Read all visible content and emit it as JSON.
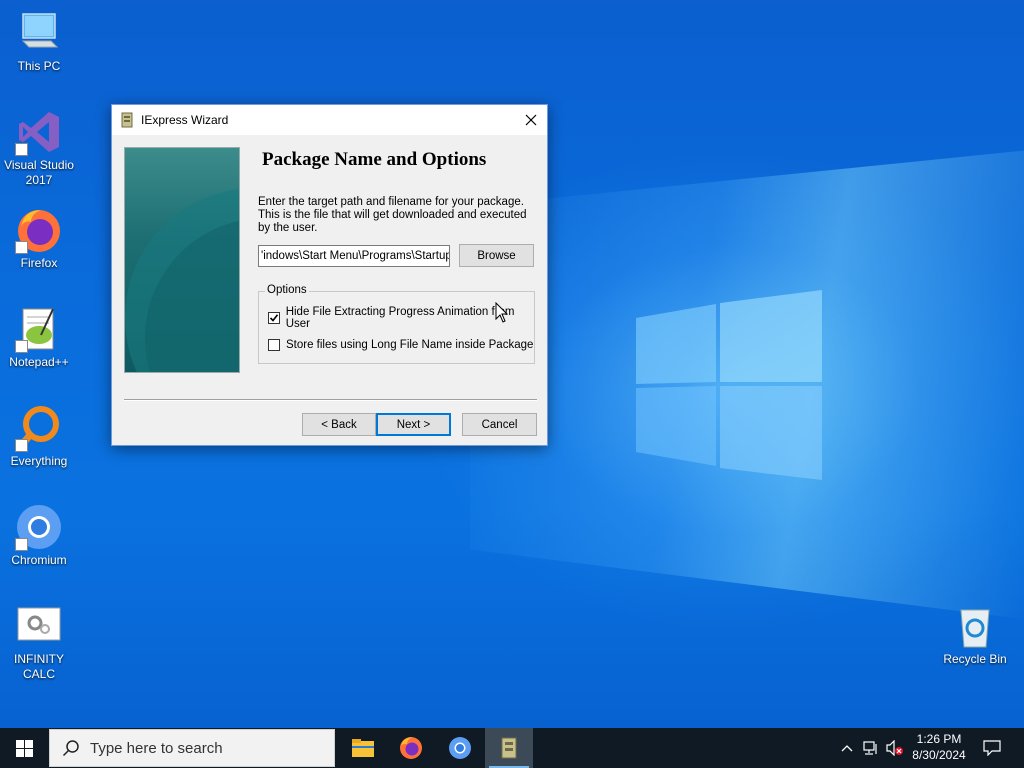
{
  "desktop": {
    "icons": [
      {
        "label": "This PC",
        "icon": "this-pc-icon"
      },
      {
        "label": "Visual Studio 2017",
        "icon": "visual-studio-icon"
      },
      {
        "label": "Firefox",
        "icon": "firefox-icon"
      },
      {
        "label": "Notepad++",
        "icon": "notepad-plus-plus-icon"
      },
      {
        "label": "Everything",
        "icon": "everything-search-icon"
      },
      {
        "label": "Chromium",
        "icon": "chromium-icon"
      },
      {
        "label": "INFINITY CALC",
        "icon": "infinity-calc-icon"
      },
      {
        "label": "Recycle Bin",
        "icon": "recycle-bin-icon"
      }
    ]
  },
  "dialog": {
    "title": "IExpress Wizard",
    "heading": "Package Name and Options",
    "description": "Enter the target path and filename for your package. This is the file that will get downloaded and executed by the user.",
    "path_value": "'indows\\Start Menu\\Programs\\Startup\\",
    "browse_label": "Browse",
    "options_legend": "Options",
    "option_hide_progress": {
      "label": "Hide File Extracting Progress Animation from User",
      "checked": true
    },
    "option_long_filename": {
      "label": "Store files using Long File Name inside Package",
      "checked": false
    },
    "back_label": "< Back",
    "next_label": "Next >",
    "cancel_label": "Cancel"
  },
  "taskbar": {
    "search_placeholder": "Type here to search",
    "apps": [
      "file-explorer-icon",
      "firefox-icon",
      "chromium-icon",
      "iexpress-icon"
    ],
    "active_app": "iexpress-icon",
    "time": "1:26 PM",
    "date": "8/30/2024"
  }
}
